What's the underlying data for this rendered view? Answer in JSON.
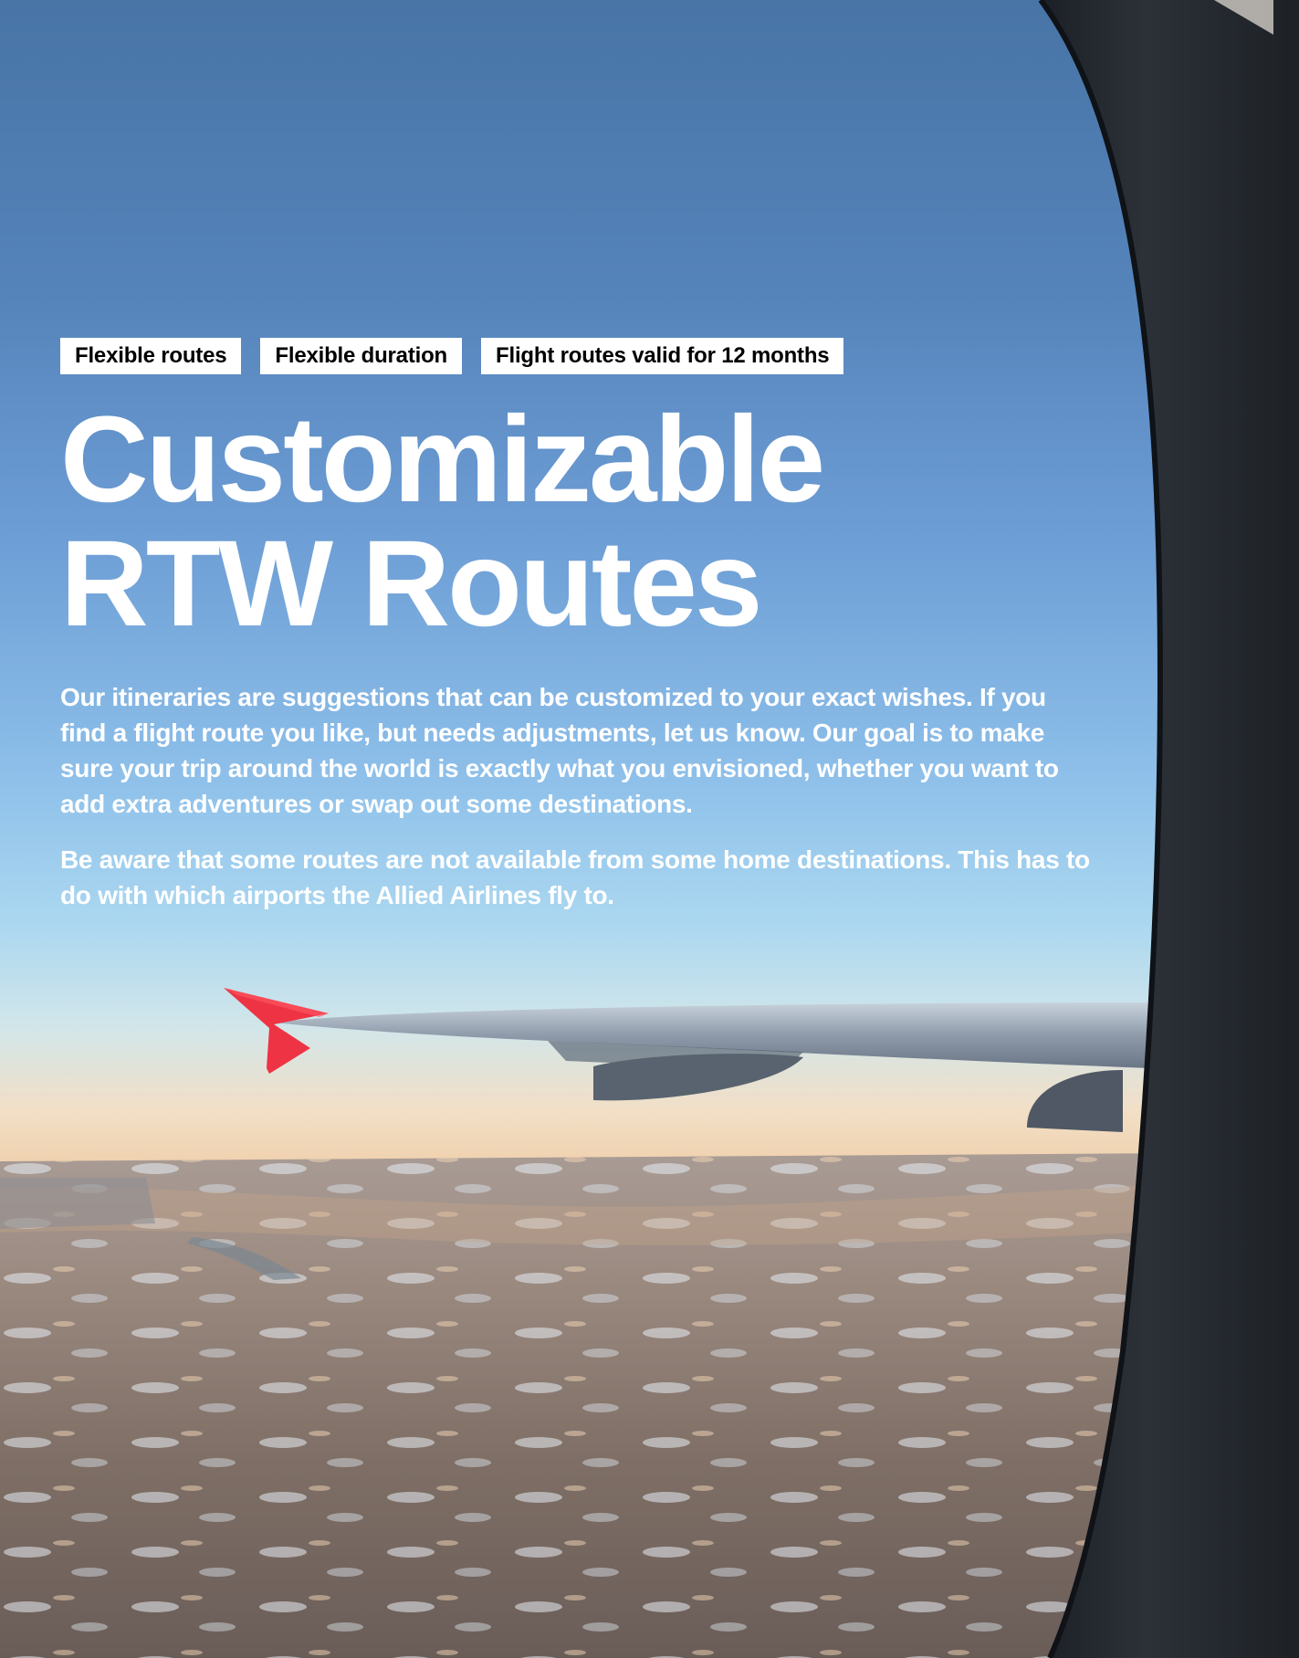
{
  "tags": [
    "Flexible routes",
    "Flexible duration",
    "Flight routes valid for 12 months"
  ],
  "title": {
    "line1": "Customizable",
    "line2": "RTW Routes"
  },
  "paragraphs": [
    "Our itineraries are suggestions that can be customized to your exact wishes. If you find a flight route you like, but needs adjustments, let us know. Our goal is to make sure your trip around the world is exactly what you envisioned, whether you want to add extra adventures or swap out some destinations.",
    "Be aware that some routes are not available from some home destinations. This has to do with which airports the Allied Airlines fly to."
  ],
  "colors": {
    "sky_top": "#4a78ab",
    "sky_horizon": "#f3dcc0",
    "wingtip": "#ee3344",
    "frame": "#22262c",
    "text": "#ffffff",
    "tag_bg": "#ffffff",
    "tag_text": "#000000"
  }
}
